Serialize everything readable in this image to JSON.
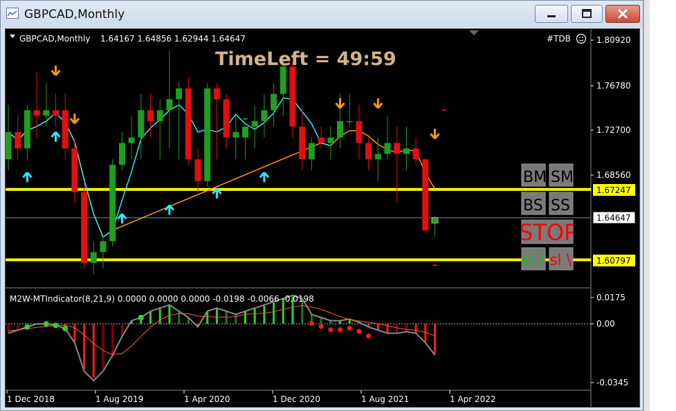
{
  "window": {
    "title": "GBPCAD,Monthly"
  },
  "chart_header": {
    "symbol_info": "GBPCAD,Monthly",
    "ohlc": "1.64167 1.64856 1.62944 1.64647",
    "indicator_tag": "#TDB",
    "timeleft": "TimeLeft = 49:59"
  },
  "price_axis": {
    "ticks": [
      "1.80920",
      "1.76780",
      "1.72700",
      "1.68560",
      "1.64647"
    ],
    "marker_labels": [
      "1.67247",
      "1.60797"
    ],
    "partial_label": "1.6..."
  },
  "panel_buttons": {
    "bm": "BM",
    "sm": "SM",
    "bs": "BS",
    "ss": "SS",
    "stop": "STOP",
    "sl_a": "sl /",
    "sl_b": "sl \\"
  },
  "indicator": {
    "label": "M2W-MTIndicator(8,21,9) 0.0000 0.0000 0.0000 -0.0198 -0.0066 -0.0198",
    "ticks": [
      "0.0175",
      "0.00",
      "-0.0345"
    ]
  },
  "time_axis": {
    "labels": [
      "1 Dec 2018",
      "1 Aug 2019",
      "1 Apr 2020",
      "1 Dec 2020",
      "1 Aug 2021",
      "1 Apr 2022"
    ]
  },
  "colors": {
    "bull": "#1f9e1f",
    "bear": "#e01010",
    "level_line": "#ffff00",
    "cyan_line": "#33e6ff",
    "orange_line": "#ff9c00"
  },
  "chart_data": {
    "type": "candlestick",
    "symbol": "GBPCAD",
    "timeframe": "Monthly",
    "ylim": [
      1.6,
      1.815
    ],
    "levels": [
      1.67247,
      1.60797
    ],
    "last": 1.64647,
    "candles": [
      {
        "o": 1.7,
        "h": 1.75,
        "l": 1.69,
        "c": 1.725
      },
      {
        "o": 1.725,
        "h": 1.74,
        "l": 1.7,
        "c": 1.71
      },
      {
        "o": 1.71,
        "h": 1.75,
        "l": 1.7,
        "c": 1.745
      },
      {
        "o": 1.745,
        "h": 1.78,
        "l": 1.72,
        "c": 1.74
      },
      {
        "o": 1.74,
        "h": 1.77,
        "l": 1.73,
        "c": 1.745
      },
      {
        "o": 1.745,
        "h": 1.76,
        "l": 1.73,
        "c": 1.74
      },
      {
        "o": 1.745,
        "h": 1.76,
        "l": 1.7,
        "c": 1.71
      },
      {
        "o": 1.71,
        "h": 1.72,
        "l": 1.66,
        "c": 1.67
      },
      {
        "o": 1.67,
        "h": 1.68,
        "l": 1.6,
        "c": 1.605
      },
      {
        "o": 1.605,
        "h": 1.625,
        "l": 1.595,
        "c": 1.615
      },
      {
        "o": 1.615,
        "h": 1.63,
        "l": 1.6,
        "c": 1.625
      },
      {
        "o": 1.625,
        "h": 1.7,
        "l": 1.62,
        "c": 1.695
      },
      {
        "o": 1.695,
        "h": 1.725,
        "l": 1.69,
        "c": 1.715
      },
      {
        "o": 1.715,
        "h": 1.74,
        "l": 1.7,
        "c": 1.72
      },
      {
        "o": 1.72,
        "h": 1.76,
        "l": 1.7,
        "c": 1.745
      },
      {
        "o": 1.745,
        "h": 1.76,
        "l": 1.72,
        "c": 1.735
      },
      {
        "o": 1.735,
        "h": 1.755,
        "l": 1.7,
        "c": 1.745
      },
      {
        "o": 1.745,
        "h": 1.8,
        "l": 1.71,
        "c": 1.755
      },
      {
        "o": 1.755,
        "h": 1.77,
        "l": 1.7,
        "c": 1.765
      },
      {
        "o": 1.765,
        "h": 1.775,
        "l": 1.695,
        "c": 1.7
      },
      {
        "o": 1.7,
        "h": 1.71,
        "l": 1.67,
        "c": 1.68
      },
      {
        "o": 1.68,
        "h": 1.77,
        "l": 1.675,
        "c": 1.765
      },
      {
        "o": 1.765,
        "h": 1.77,
        "l": 1.7,
        "c": 1.755
      },
      {
        "o": 1.755,
        "h": 1.76,
        "l": 1.71,
        "c": 1.72
      },
      {
        "o": 1.72,
        "h": 1.74,
        "l": 1.7,
        "c": 1.725
      },
      {
        "o": 1.72,
        "h": 1.73,
        "l": 1.7,
        "c": 1.73
      },
      {
        "o": 1.73,
        "h": 1.75,
        "l": 1.71,
        "c": 1.735
      },
      {
        "o": 1.735,
        "h": 1.76,
        "l": 1.72,
        "c": 1.745
      },
      {
        "o": 1.745,
        "h": 1.77,
        "l": 1.73,
        "c": 1.76
      },
      {
        "o": 1.76,
        "h": 1.79,
        "l": 1.74,
        "c": 1.785
      },
      {
        "o": 1.785,
        "h": 1.79,
        "l": 1.72,
        "c": 1.73
      },
      {
        "o": 1.73,
        "h": 1.75,
        "l": 1.69,
        "c": 1.7
      },
      {
        "o": 1.7,
        "h": 1.72,
        "l": 1.69,
        "c": 1.715
      },
      {
        "o": 1.72,
        "h": 1.73,
        "l": 1.71,
        "c": 1.715
      },
      {
        "o": 1.715,
        "h": 1.73,
        "l": 1.7,
        "c": 1.72
      },
      {
        "o": 1.72,
        "h": 1.76,
        "l": 1.71,
        "c": 1.735
      },
      {
        "o": 1.735,
        "h": 1.76,
        "l": 1.73,
        "c": 1.735
      },
      {
        "o": 1.735,
        "h": 1.75,
        "l": 1.7,
        "c": 1.715
      },
      {
        "o": 1.715,
        "h": 1.72,
        "l": 1.69,
        "c": 1.7
      },
      {
        "o": 1.7,
        "h": 1.72,
        "l": 1.68,
        "c": 1.705
      },
      {
        "o": 1.705,
        "h": 1.74,
        "l": 1.7,
        "c": 1.715
      },
      {
        "o": 1.715,
        "h": 1.73,
        "l": 1.66,
        "c": 1.705
      },
      {
        "o": 1.705,
        "h": 1.73,
        "l": 1.69,
        "c": 1.71
      },
      {
        "o": 1.71,
        "h": 1.72,
        "l": 1.695,
        "c": 1.7
      },
      {
        "o": 1.7,
        "h": 1.7,
        "l": 1.64,
        "c": 1.635
      },
      {
        "o": 1.64167,
        "h": 1.64856,
        "l": 1.62944,
        "c": 1.64647
      }
    ],
    "histogram": [
      -0.006,
      -0.004,
      -0.002,
      0.0,
      0.0,
      -0.001,
      -0.003,
      -0.012,
      -0.03,
      -0.036,
      -0.03,
      -0.02,
      -0.008,
      0.002,
      0.004,
      0.008,
      0.01,
      0.012,
      0.008,
      0.004,
      -0.002,
      0.008,
      0.01,
      0.008,
      0.006,
      0.008,
      0.01,
      0.012,
      0.014,
      0.016,
      0.018,
      0.016,
      0.006,
      0.004,
      0.002,
      0.002,
      0.003,
      0.001,
      -0.002,
      -0.004,
      -0.006,
      -0.006,
      -0.005,
      -0.006,
      -0.012,
      -0.0198
    ]
  }
}
